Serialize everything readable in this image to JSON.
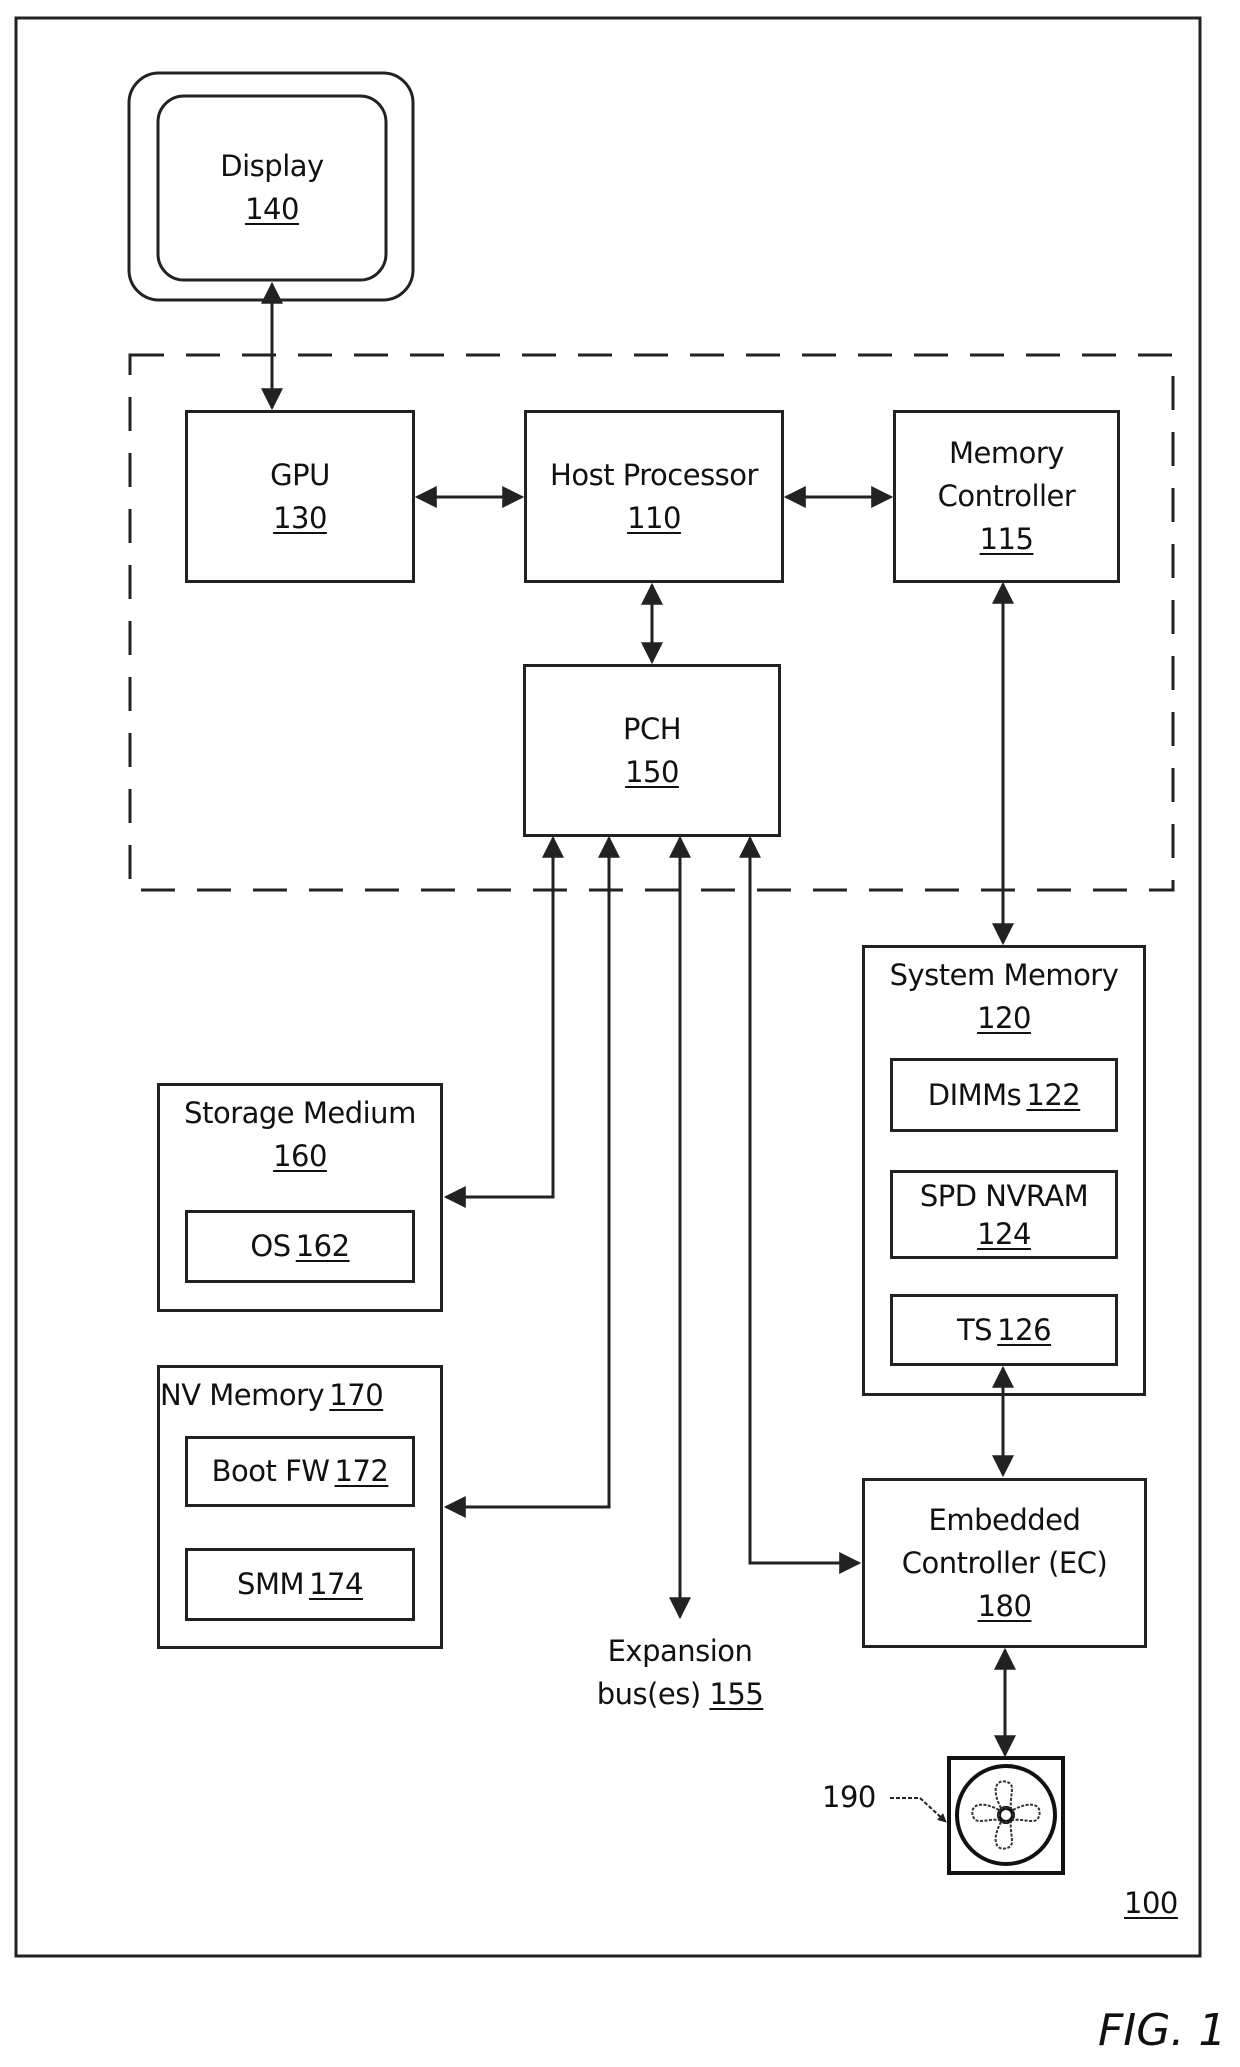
{
  "figure": {
    "label": "FIG. 1",
    "system_ref": "100"
  },
  "display": {
    "name": "Display",
    "ref": "140"
  },
  "gpu": {
    "name": "GPU",
    "ref": "130"
  },
  "host_processor": {
    "name": "Host Processor",
    "ref": "110"
  },
  "memory_controller": {
    "name_line1": "Memory",
    "name_line2": "Controller",
    "ref": "115"
  },
  "pch": {
    "name": "PCH",
    "ref": "150"
  },
  "system_memory": {
    "name": "System Memory",
    "ref": "120",
    "children": [
      {
        "name": "DIMMs",
        "ref": "122"
      },
      {
        "name": "SPD NVRAM",
        "ref": "124"
      },
      {
        "name": "TS",
        "ref": "126"
      }
    ]
  },
  "storage_medium": {
    "name": "Storage Medium",
    "ref": "160",
    "children": [
      {
        "name": "OS",
        "ref": "162"
      }
    ]
  },
  "nv_memory": {
    "name": "NV Memory",
    "ref": "170",
    "children": [
      {
        "name": "Boot FW",
        "ref": "172"
      },
      {
        "name": "SMM",
        "ref": "174"
      }
    ]
  },
  "expansion_bus": {
    "line1": "Expansion",
    "line2": "bus(es)",
    "ref": "155"
  },
  "embedded_controller": {
    "name_line1": "Embedded",
    "name_line2": "Controller (EC)",
    "ref": "180"
  },
  "fan": {
    "ref": "190",
    "icon": "fan-icon"
  }
}
